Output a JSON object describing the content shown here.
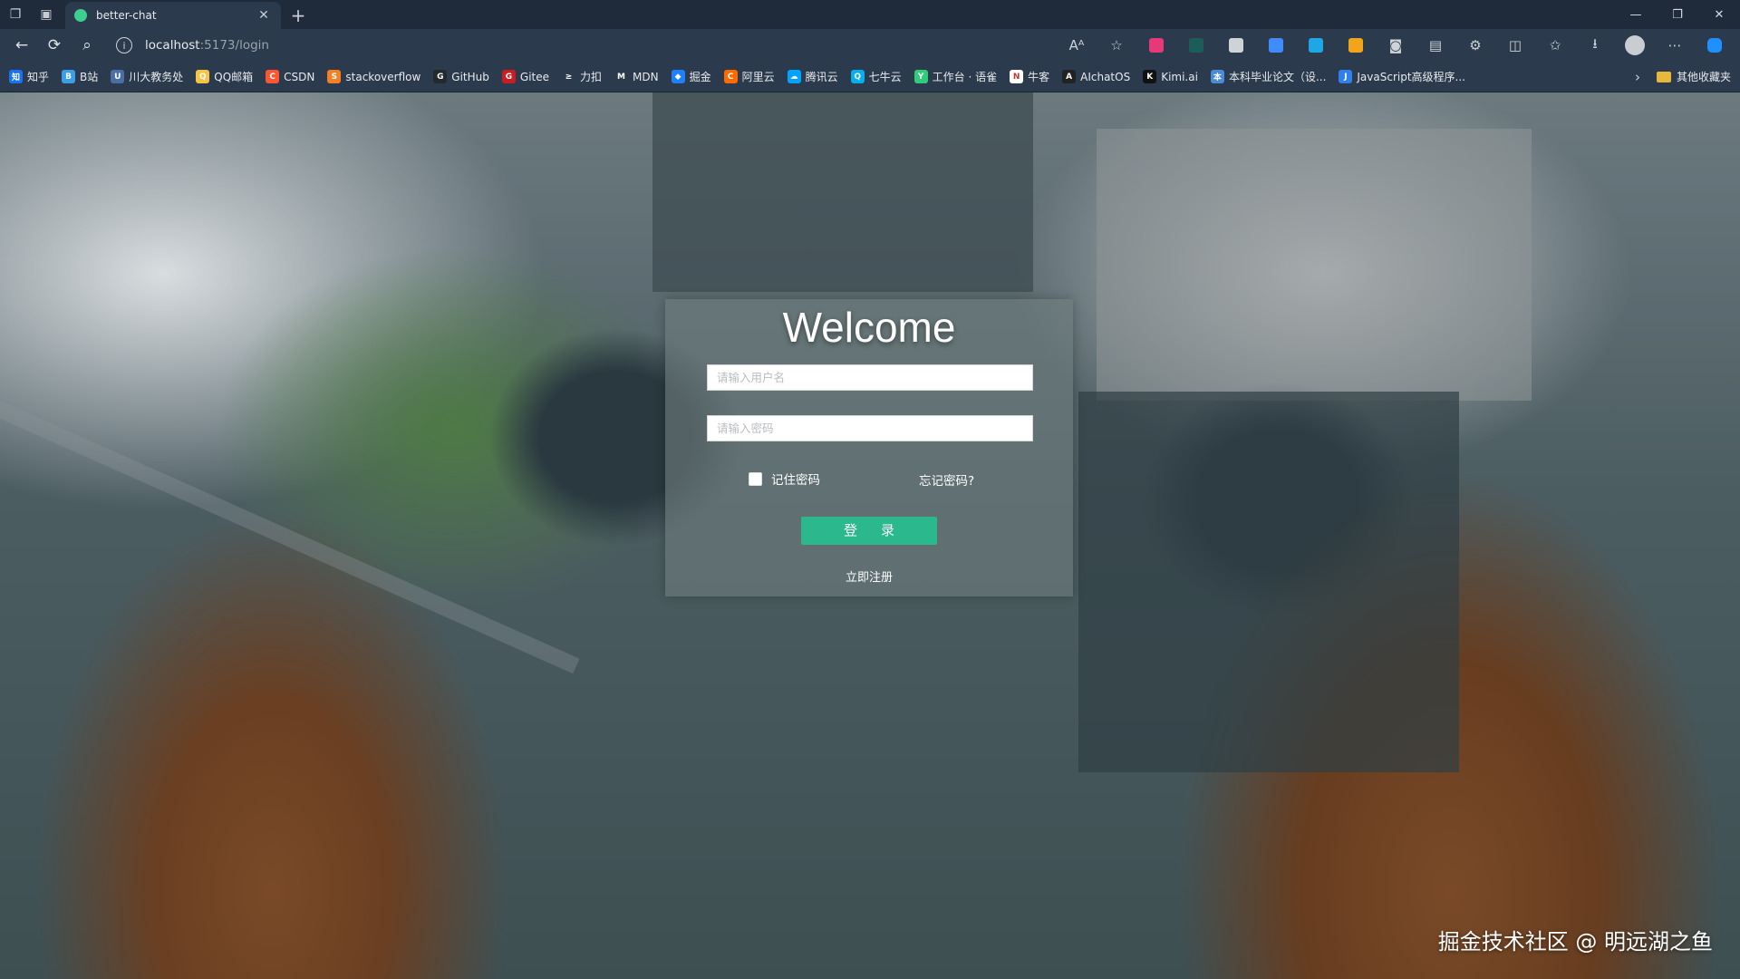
{
  "browser": {
    "tab": {
      "title": "better-chat"
    },
    "address": {
      "host": "localhost",
      "path": ":5173/login"
    },
    "extension_colors": [
      "#e5397a",
      "#1c5d5a",
      "#cfd3d8",
      "#3f8cff",
      "#1ea7e4",
      "#f2a41a",
      "#cfd3d8",
      "#ffffff",
      "#cfd3d8"
    ]
  },
  "bookmarks": [
    {
      "label": "知乎",
      "icon": "zhihu-icon",
      "color": "#1772f6",
      "glyph": "知"
    },
    {
      "label": "B站",
      "icon": "bilibili-icon",
      "color": "#3aa0e6",
      "glyph": "B"
    },
    {
      "label": "川大教务处",
      "icon": "scu-icon",
      "color": "#4a6fa5",
      "glyph": "U"
    },
    {
      "label": "QQ邮箱",
      "icon": "qqmail-icon",
      "color": "#f5c443",
      "glyph": "Q"
    },
    {
      "label": "CSDN",
      "icon": "csdn-icon",
      "color": "#fc5531",
      "glyph": "C"
    },
    {
      "label": "stackoverflow",
      "icon": "stackoverflow-icon",
      "color": "#f48024",
      "glyph": "S"
    },
    {
      "label": "GitHub",
      "icon": "github-icon",
      "color": "#24292e",
      "glyph": "G"
    },
    {
      "label": "Gitee",
      "icon": "gitee-icon",
      "color": "#c71d23",
      "glyph": "G"
    },
    {
      "label": "力扣",
      "icon": "leetcode-icon",
      "color": "#2b3a4c",
      "glyph": "≥"
    },
    {
      "label": "MDN",
      "icon": "mdn-icon",
      "color": "#2b3a4c",
      "glyph": "M"
    },
    {
      "label": "掘金",
      "icon": "juejin-icon",
      "color": "#1e80ff",
      "glyph": "◆"
    },
    {
      "label": "阿里云",
      "icon": "aliyun-icon",
      "color": "#ff6a00",
      "glyph": "C"
    },
    {
      "label": "腾讯云",
      "icon": "tencentcloud-icon",
      "color": "#00a3ff",
      "glyph": "☁"
    },
    {
      "label": "七牛云",
      "icon": "qiniu-icon",
      "color": "#06aeef",
      "glyph": "Q"
    },
    {
      "label": "工作台 · 语雀",
      "icon": "yuque-icon",
      "color": "#31cc79",
      "glyph": "Y"
    },
    {
      "label": "牛客",
      "icon": "nowcoder-icon",
      "color": "#ffffff",
      "glyph": "N"
    },
    {
      "label": "AIchatOS",
      "icon": "aichatos-icon",
      "color": "#222222",
      "glyph": "A"
    },
    {
      "label": "Kimi.ai",
      "icon": "kimi-icon",
      "color": "#111111",
      "glyph": "K"
    },
    {
      "label": "本科毕业论文（设...",
      "icon": "thesis-icon",
      "color": "#4a8bd8",
      "glyph": "本"
    },
    {
      "label": "JavaScript高级程序...",
      "icon": "javascript-book-icon",
      "color": "#2f80ed",
      "glyph": "J"
    }
  ],
  "bookmarks_folder": {
    "label": "其他收藏夹"
  },
  "login": {
    "title": "Welcome",
    "username_placeholder": "请输入用户名",
    "password_placeholder": "请输入密码",
    "remember_label": "记住密码",
    "forgot_label": "忘记密码?",
    "submit_label": "登录",
    "register_label": "立即注册",
    "accent_color": "#2bb88c"
  },
  "watermark": "掘金技术社区 @ 明远湖之鱼"
}
